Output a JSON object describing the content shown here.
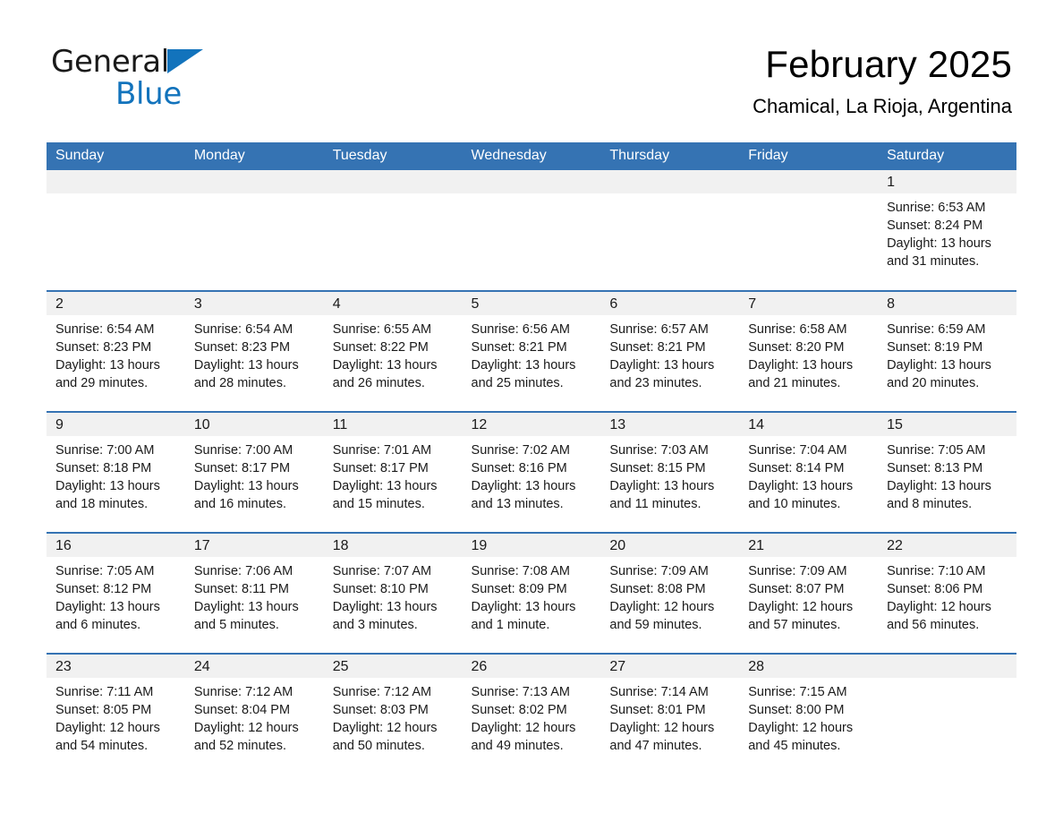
{
  "brand": {
    "name_part1": "General",
    "name_part2": "Blue",
    "triangle_color": "#1273bc",
    "text_color": "#1a1a1a"
  },
  "header": {
    "month_title": "February 2025",
    "location": "Chamical, La Rioja, Argentina"
  },
  "theme": {
    "header_blue": "#3573b3",
    "day_band_gray": "#f1f1f1",
    "row_separator": "#3573b3",
    "text": "#1a1a1a",
    "page_background": "#ffffff"
  },
  "weekday_headers": [
    "Sunday",
    "Monday",
    "Tuesday",
    "Wednesday",
    "Thursday",
    "Friday",
    "Saturday"
  ],
  "labels": {
    "sunrise_prefix": "Sunrise:",
    "sunset_prefix": "Sunset:",
    "daylight_prefix": "Daylight:"
  },
  "weeks": [
    [
      {
        "day": "",
        "blank": true
      },
      {
        "day": "",
        "blank": true
      },
      {
        "day": "",
        "blank": true
      },
      {
        "day": "",
        "blank": true
      },
      {
        "day": "",
        "blank": true
      },
      {
        "day": "",
        "blank": true
      },
      {
        "day": "1",
        "sunrise": "Sunrise: 6:53 AM",
        "sunset": "Sunset: 8:24 PM",
        "daylight_line1": "Daylight: 13 hours",
        "daylight_line2": "and 31 minutes."
      }
    ],
    [
      {
        "day": "2",
        "sunrise": "Sunrise: 6:54 AM",
        "sunset": "Sunset: 8:23 PM",
        "daylight_line1": "Daylight: 13 hours",
        "daylight_line2": "and 29 minutes."
      },
      {
        "day": "3",
        "sunrise": "Sunrise: 6:54 AM",
        "sunset": "Sunset: 8:23 PM",
        "daylight_line1": "Daylight: 13 hours",
        "daylight_line2": "and 28 minutes."
      },
      {
        "day": "4",
        "sunrise": "Sunrise: 6:55 AM",
        "sunset": "Sunset: 8:22 PM",
        "daylight_line1": "Daylight: 13 hours",
        "daylight_line2": "and 26 minutes."
      },
      {
        "day": "5",
        "sunrise": "Sunrise: 6:56 AM",
        "sunset": "Sunset: 8:21 PM",
        "daylight_line1": "Daylight: 13 hours",
        "daylight_line2": "and 25 minutes."
      },
      {
        "day": "6",
        "sunrise": "Sunrise: 6:57 AM",
        "sunset": "Sunset: 8:21 PM",
        "daylight_line1": "Daylight: 13 hours",
        "daylight_line2": "and 23 minutes."
      },
      {
        "day": "7",
        "sunrise": "Sunrise: 6:58 AM",
        "sunset": "Sunset: 8:20 PM",
        "daylight_line1": "Daylight: 13 hours",
        "daylight_line2": "and 21 minutes."
      },
      {
        "day": "8",
        "sunrise": "Sunrise: 6:59 AM",
        "sunset": "Sunset: 8:19 PM",
        "daylight_line1": "Daylight: 13 hours",
        "daylight_line2": "and 20 minutes."
      }
    ],
    [
      {
        "day": "9",
        "sunrise": "Sunrise: 7:00 AM",
        "sunset": "Sunset: 8:18 PM",
        "daylight_line1": "Daylight: 13 hours",
        "daylight_line2": "and 18 minutes."
      },
      {
        "day": "10",
        "sunrise": "Sunrise: 7:00 AM",
        "sunset": "Sunset: 8:17 PM",
        "daylight_line1": "Daylight: 13 hours",
        "daylight_line2": "and 16 minutes."
      },
      {
        "day": "11",
        "sunrise": "Sunrise: 7:01 AM",
        "sunset": "Sunset: 8:17 PM",
        "daylight_line1": "Daylight: 13 hours",
        "daylight_line2": "and 15 minutes."
      },
      {
        "day": "12",
        "sunrise": "Sunrise: 7:02 AM",
        "sunset": "Sunset: 8:16 PM",
        "daylight_line1": "Daylight: 13 hours",
        "daylight_line2": "and 13 minutes."
      },
      {
        "day": "13",
        "sunrise": "Sunrise: 7:03 AM",
        "sunset": "Sunset: 8:15 PM",
        "daylight_line1": "Daylight: 13 hours",
        "daylight_line2": "and 11 minutes."
      },
      {
        "day": "14",
        "sunrise": "Sunrise: 7:04 AM",
        "sunset": "Sunset: 8:14 PM",
        "daylight_line1": "Daylight: 13 hours",
        "daylight_line2": "and 10 minutes."
      },
      {
        "day": "15",
        "sunrise": "Sunrise: 7:05 AM",
        "sunset": "Sunset: 8:13 PM",
        "daylight_line1": "Daylight: 13 hours",
        "daylight_line2": "and 8 minutes."
      }
    ],
    [
      {
        "day": "16",
        "sunrise": "Sunrise: 7:05 AM",
        "sunset": "Sunset: 8:12 PM",
        "daylight_line1": "Daylight: 13 hours",
        "daylight_line2": "and 6 minutes."
      },
      {
        "day": "17",
        "sunrise": "Sunrise: 7:06 AM",
        "sunset": "Sunset: 8:11 PM",
        "daylight_line1": "Daylight: 13 hours",
        "daylight_line2": "and 5 minutes."
      },
      {
        "day": "18",
        "sunrise": "Sunrise: 7:07 AM",
        "sunset": "Sunset: 8:10 PM",
        "daylight_line1": "Daylight: 13 hours",
        "daylight_line2": "and 3 minutes."
      },
      {
        "day": "19",
        "sunrise": "Sunrise: 7:08 AM",
        "sunset": "Sunset: 8:09 PM",
        "daylight_line1": "Daylight: 13 hours",
        "daylight_line2": "and 1 minute."
      },
      {
        "day": "20",
        "sunrise": "Sunrise: 7:09 AM",
        "sunset": "Sunset: 8:08 PM",
        "daylight_line1": "Daylight: 12 hours",
        "daylight_line2": "and 59 minutes."
      },
      {
        "day": "21",
        "sunrise": "Sunrise: 7:09 AM",
        "sunset": "Sunset: 8:07 PM",
        "daylight_line1": "Daylight: 12 hours",
        "daylight_line2": "and 57 minutes."
      },
      {
        "day": "22",
        "sunrise": "Sunrise: 7:10 AM",
        "sunset": "Sunset: 8:06 PM",
        "daylight_line1": "Daylight: 12 hours",
        "daylight_line2": "and 56 minutes."
      }
    ],
    [
      {
        "day": "23",
        "sunrise": "Sunrise: 7:11 AM",
        "sunset": "Sunset: 8:05 PM",
        "daylight_line1": "Daylight: 12 hours",
        "daylight_line2": "and 54 minutes."
      },
      {
        "day": "24",
        "sunrise": "Sunrise: 7:12 AM",
        "sunset": "Sunset: 8:04 PM",
        "daylight_line1": "Daylight: 12 hours",
        "daylight_line2": "and 52 minutes."
      },
      {
        "day": "25",
        "sunrise": "Sunrise: 7:12 AM",
        "sunset": "Sunset: 8:03 PM",
        "daylight_line1": "Daylight: 12 hours",
        "daylight_line2": "and 50 minutes."
      },
      {
        "day": "26",
        "sunrise": "Sunrise: 7:13 AM",
        "sunset": "Sunset: 8:02 PM",
        "daylight_line1": "Daylight: 12 hours",
        "daylight_line2": "and 49 minutes."
      },
      {
        "day": "27",
        "sunrise": "Sunrise: 7:14 AM",
        "sunset": "Sunset: 8:01 PM",
        "daylight_line1": "Daylight: 12 hours",
        "daylight_line2": "and 47 minutes."
      },
      {
        "day": "28",
        "sunrise": "Sunrise: 7:15 AM",
        "sunset": "Sunset: 8:00 PM",
        "daylight_line1": "Daylight: 12 hours",
        "daylight_line2": "and 45 minutes."
      },
      {
        "day": "",
        "blank": true
      }
    ]
  ]
}
